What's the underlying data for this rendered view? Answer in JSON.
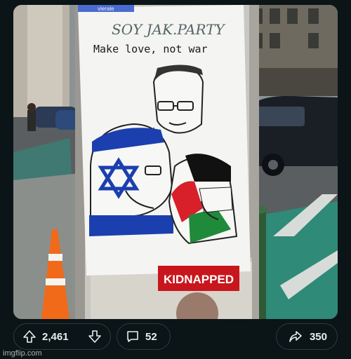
{
  "post_image": {
    "poster": {
      "handwritten_header": "SOY JAK.PARTY",
      "caption": "Make love, not war",
      "banner": "KIDNAPPED",
      "partial_top_text": "vierale"
    }
  },
  "actions": {
    "upvote_icon": "arrow-up-icon",
    "vote_count": "2,461",
    "downvote_icon": "arrow-down-icon",
    "comment_icon": "speech-bubble-icon",
    "comment_count": "52",
    "share_icon": "share-arrow-icon",
    "share_count": "350"
  },
  "watermark": "imgflip.com",
  "colors": {
    "background": "#0b1416",
    "pill_border": "#2a3c42",
    "israel_blue": "#1b3fae",
    "palestine_red": "#d8202a",
    "palestine_green": "#1f8a3a",
    "kidnapped_red": "#c8161c"
  }
}
